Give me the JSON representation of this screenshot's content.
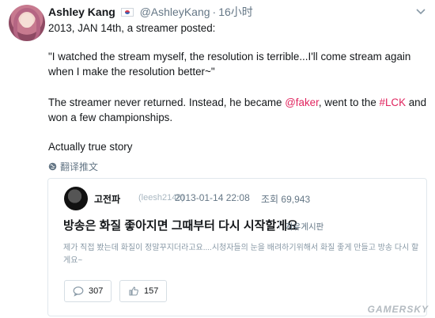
{
  "tweet": {
    "name": "Ashley Kang",
    "handle": "@AshleyKang",
    "time": "16小时",
    "paragraph1": "2013, JAN 14th, a streamer posted:",
    "paragraph2": "\"I watched the stream myself, the resolution is terrible...I'll come stream again when I make the resolution better~\"",
    "paragraph3_a": "The streamer never returned. Instead, he became ",
    "mention": "@faker",
    "paragraph3_b": ", went to the ",
    "hashtag": "#LCK",
    "paragraph3_c": " and won a few championships.",
    "paragraph4": "Actually true story",
    "translate_label": "翻译推文"
  },
  "card": {
    "author": "고전파",
    "author_handle": "(leesh2148)",
    "date": "2013-01-14 22:08",
    "views": "조회 69,943",
    "title": "방송은 화질 좋아지면 그때부터 다시 시작할게요",
    "board": "자유게시판",
    "text": "제가 직접 봤는데 화질이 정말꾸지더라고요....시청자들의 눈을 배려하기위해서 화질 좋게 만들고 방송 다시 할게요~",
    "comments": "307",
    "likes": "157"
  },
  "watermark": "GAMERSKY",
  "colors": {
    "link": "#e0245e",
    "secondary": "#657786",
    "border": "#e1e8ed"
  },
  "icons": [
    "chevron-down-icon",
    "globe-icon",
    "comment-icon",
    "like-icon",
    "korea-flag-icon"
  ]
}
